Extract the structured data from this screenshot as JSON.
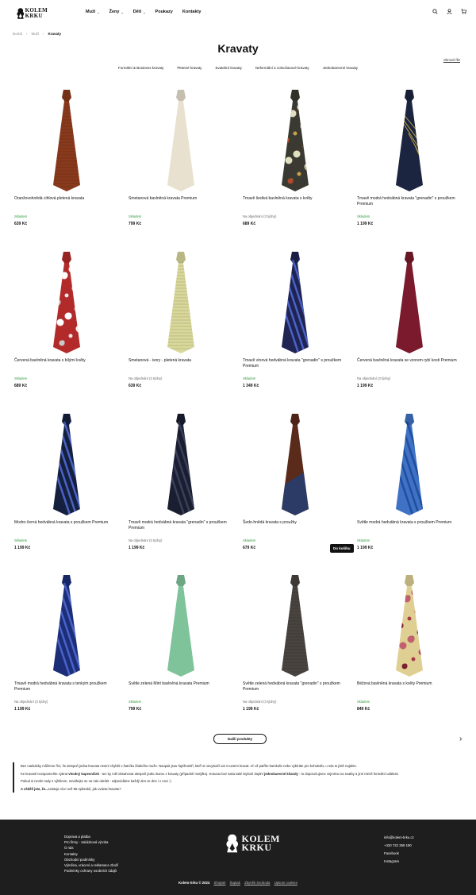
{
  "header": {
    "logo_line1": "KOLEM",
    "logo_line2": "KRKU",
    "nav": [
      {
        "label": "Muži",
        "has_menu": true
      },
      {
        "label": "Ženy",
        "has_menu": true
      },
      {
        "label": "Děti",
        "has_menu": true
      },
      {
        "label": "Poukazy",
        "has_menu": false
      },
      {
        "label": "Kontakty",
        "has_menu": false
      }
    ]
  },
  "breadcrumb": [
    "Domů",
    "Muži",
    "Kravaty"
  ],
  "page_title": "Kravaty",
  "clear_filter": "Obnovit filtr",
  "categories": [
    "Formální & Business kravaty",
    "Pletené kravaty",
    "Svatební kravaty",
    "Neformální a volnočasové kravaty",
    "Jednobarevné kravaty"
  ],
  "products": [
    {
      "name": "Oranžovohnědá cihlová pletená kravata",
      "stock": "Skladem",
      "in_stock": true,
      "price": "639 Kč",
      "color": "#8a3a1c",
      "pattern": "knit"
    },
    {
      "name": "Smetanová bavlněná kravata Premium",
      "stock": "Skladem",
      "in_stock": true,
      "price": "799 Kč",
      "color": "#e9e1cf",
      "pattern": "plain"
    },
    {
      "name": "Tmavě šedivá bavlněná kravata s květy",
      "stock": "Na objednání (3 týdny)",
      "in_stock": false,
      "price": "689 Kč",
      "color": "#3a3a32",
      "pattern": "floral"
    },
    {
      "name": "Tmavě modrá hedvábná kravata \"grenadin\" s proužkem Premium",
      "stock": "Skladem",
      "in_stock": true,
      "price": "1 199 Kč",
      "color": "#1c2540",
      "pattern": "stripe-gold"
    },
    {
      "name": "Červená bavlněná kravata s bílými květy",
      "stock": "Skladem",
      "in_stock": true,
      "price": "689 Kč",
      "color": "#b32a2a",
      "pattern": "floral-white"
    },
    {
      "name": "Smetanová - ivory - pletená kravata",
      "stock": "Na objednání (3 týdny)",
      "in_stock": false,
      "price": "639 Kč",
      "color": "#d9d89a",
      "pattern": "knit"
    },
    {
      "name": "Tmavě vínová hedvábná kravata \"grenadin\" s proužkem Premium",
      "stock": "Skladem",
      "in_stock": true,
      "price": "1 349 Kč",
      "color": "#1f2452",
      "pattern": "stripe-blue"
    },
    {
      "name": "Červená bavlněná kravata se vzorem rybí kosti Premium",
      "stock": "Na objednání (3 týdny)",
      "in_stock": false,
      "price": "1 199 Kč",
      "color": "#7a1a2c",
      "pattern": "plain"
    },
    {
      "name": "Modro-černá hedvábná kravata s proužkem Premium",
      "stock": "Skladem",
      "in_stock": true,
      "price": "1 199 Kč",
      "color": "#14203d",
      "pattern": "stripe-blue"
    },
    {
      "name": "Tmavě modrá hedvábná kravata \"grenadin\" s proužkem Premium",
      "stock": "Na objednání (3 týdny)",
      "in_stock": false,
      "price": "1 199 Kč",
      "color": "#1a1e30",
      "pattern": "stripe-dark"
    },
    {
      "name": "Šedo-hnědá kravata s proužky",
      "stock": "Skladem",
      "in_stock": true,
      "price": "679 Kč",
      "color": "#5a2a1a",
      "pattern": "block"
    },
    {
      "name": "Světle modrá hedvábná kravata s proužkem Premium",
      "stock": "Skladem",
      "in_stock": true,
      "price": "1 199 Kč",
      "color": "#3f72c4",
      "pattern": "stripe-light"
    },
    {
      "name": "Tmavě modrá hedvábná kravata s tenkým proužkem Premium",
      "stock": "Na objednání (3 týdny)",
      "in_stock": false,
      "price": "1 199 Kč",
      "color": "#1c2e78",
      "pattern": "stripe-blue"
    },
    {
      "name": "Světle zelená Mint bavlněná kravata Premium",
      "stock": "Skladem",
      "in_stock": true,
      "price": "799 Kč",
      "color": "#7fc39a",
      "pattern": "plain"
    },
    {
      "name": "Světle zelená hedvábná kravata \"grenadin\" s proužkem Premium",
      "stock": "Na objednání (3 týdny)",
      "in_stock": false,
      "price": "1 199 Kč",
      "color": "#4a4440",
      "pattern": "knit"
    },
    {
      "name": "Béžová bavlněná kravata s květy Premium",
      "stock": "Skladem",
      "in_stock": true,
      "price": "849 Kč",
      "color": "#e0cf93",
      "pattern": "floral-red"
    }
  ],
  "cart_tooltip": "Do košíku",
  "more_button": "Další produkty",
  "description": {
    "p1": "Bez nadsázky můžeme říct, že alespoň jedna kravata nesmí chybět v šatníku žádného muže. Naopak jsou fajnšmekři, kteří si nevystačí ani s tuctem kravat. Ať už patříte kamkoliv nebo vybíráte pro kohokoliv, u nás to jistě najdete.",
    "p2_a": "Ke kravatě nezapomeňte vybrat ",
    "p2_b": "vhodný kapesníček",
    "p2_c": " - ten by měl obsahovat alespoň jednu barvu z kravaty (případně motýlku). Kravatu bez saka také stylově doplní ",
    "p2_d": "jednobarevné kšandy",
    "p2_e": " - to doporučujeme zejména na svatby a jiné méně formální události.",
    "p3": "Pokud si nevíte rady s výběrem, neváhejte se na nás obrátit - odpovídáme každý den ve dne i v noci :)",
    "p4_a": "A věděli jste, že...",
    "p4_b": "existuje více než 85 způsobů, jak uvázat kravatu?"
  },
  "footer": {
    "links": [
      "Doprava a platba",
      "Pro firmy - zakázková výroba",
      "O nás",
      "Kontakty",
      "Obchodní podmínky",
      "Výměna, vrácení a reklamace zboží",
      "Podmínky ochrany osobních údajů"
    ],
    "logo_line1": "KOLEM",
    "logo_line2": "KRKU",
    "contact": [
      "info@kolem-krku.cz",
      "+420 722 359 190",
      "Facebook",
      "Instagram"
    ],
    "copyright": "Kolem Krku © 2024",
    "credits": [
      "Shoptet",
      "Šaptak",
      "Zbyněk Svoboda",
      "Upsum cookies"
    ]
  }
}
